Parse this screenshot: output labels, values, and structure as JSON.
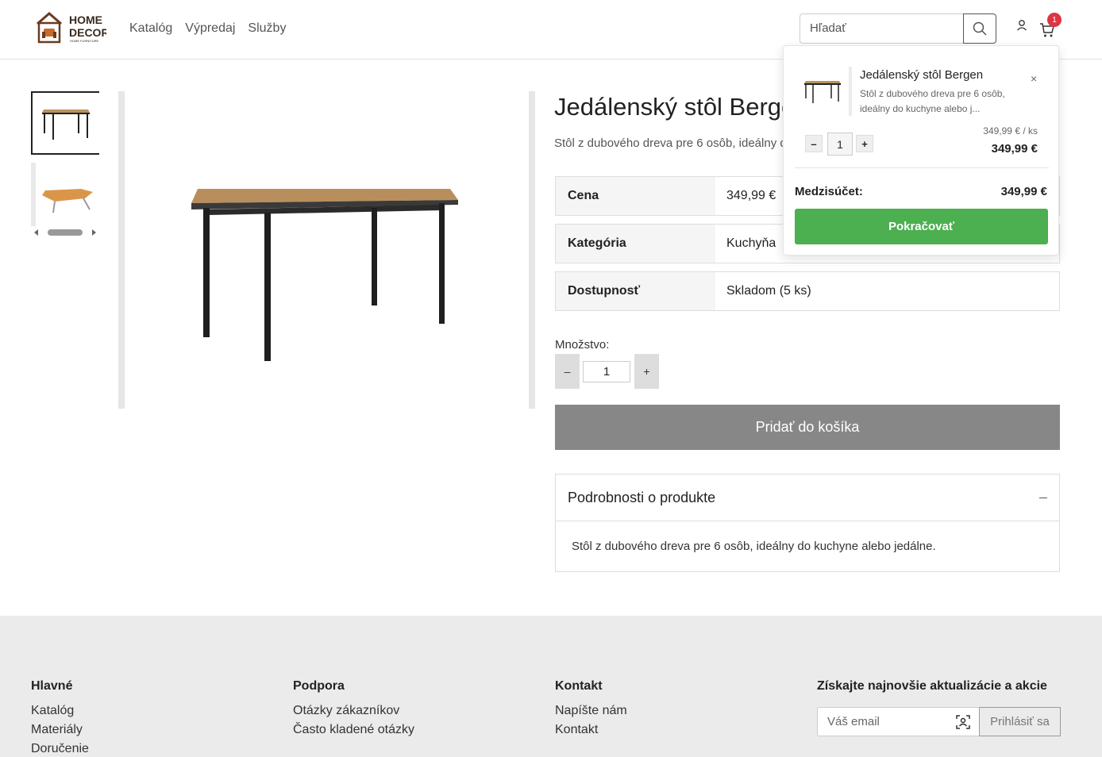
{
  "header": {
    "logo_line1": "HOME",
    "logo_line2": "DECOR",
    "logo_tagline": "HOME FURNITURE",
    "nav": [
      "Katalóg",
      "Výpredaj",
      "Služby"
    ],
    "search_placeholder": "Hľadať",
    "cart_count": "1"
  },
  "product": {
    "title": "Jedálenský stôl Bergen",
    "subtitle": "Stôl z dubového dreva pre 6 osôb, ideálny do kuchyne alebo jedálne.",
    "attributes": [
      {
        "label": "Cena",
        "value": "349,99 €"
      },
      {
        "label": "Kategória",
        "value": "Kuchyňa"
      },
      {
        "label": "Dostupnosť",
        "value": "Skladom (5 ks)"
      }
    ],
    "quantity_label": "Množstvo:",
    "quantity": "1",
    "minus": "–",
    "plus": "+",
    "add_to_cart": "Pridať do košíka",
    "details_title": "Podrobnosti o produkte",
    "details_text": "Stôl z dubového dreva pre 6 osôb, ideálny do kuchyne alebo jedálne."
  },
  "minicart": {
    "item_name": "Jedálenský stôl Bergen",
    "item_desc": "Stôl z dubového dreva pre 6 osôb, ideálny do kuchyne alebo j...",
    "close": "×",
    "minus": "–",
    "plus": "+",
    "qty": "1",
    "unit_price": "349,99 € / ks",
    "line_total": "349,99 €",
    "subtotal_label": "Medzisúčet:",
    "subtotal": "349,99 €",
    "continue": "Pokračovať"
  },
  "footer": {
    "col1": {
      "title": "Hlavné",
      "links": [
        "Katalóg",
        "Materiály",
        "Doručenie"
      ]
    },
    "col2": {
      "title": "Podpora",
      "links": [
        "Otázky zákazníkov",
        "Často kladené otázky"
      ]
    },
    "col3": {
      "title": "Kontakt",
      "links": [
        "Napíšte nám",
        "Kontakt"
      ]
    },
    "newsletter_title": "Získajte najnovšie aktualizácie a akcie",
    "email_placeholder": "Váš email",
    "subscribe": "Prihlásiť sa"
  },
  "colors": {
    "accent_green": "#4caf50",
    "badge_red": "#dc3545",
    "button_gray": "#878787",
    "logo_brown": "#6b3a1f"
  }
}
